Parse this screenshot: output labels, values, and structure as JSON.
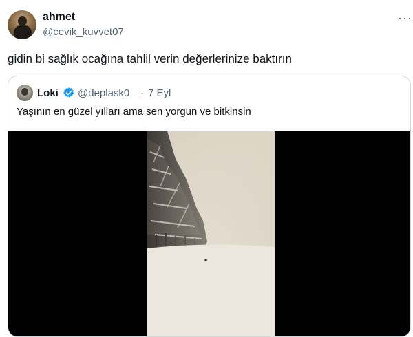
{
  "tweet": {
    "author_name": "ahmet",
    "author_handle": "@cevik_kuvvet07",
    "text": "gidin bi sağlık ocağına tahlil verin değerlerinize baktırın",
    "more_icon": "more-horizontal-icon"
  },
  "quoted": {
    "author_name": "Loki",
    "author_handle": "@deplask0",
    "separator": "·",
    "date": "7 Eyl",
    "text": "Yaşının en güzel yılları ama sen yorgun ve bitkinsin",
    "verified_icon": "verified-badge-icon",
    "verified_color": "#1d9bf0",
    "media": "snowy-forest-video"
  }
}
